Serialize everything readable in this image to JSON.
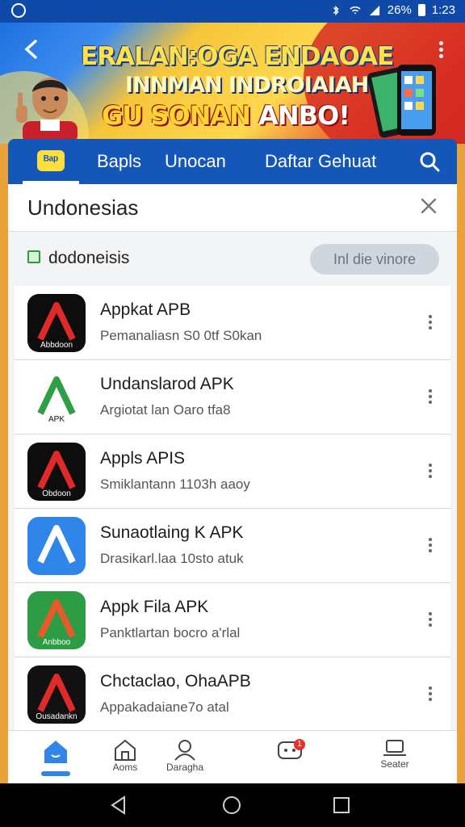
{
  "status_bar": {
    "battery": "26%",
    "time": "1:23"
  },
  "banner": {
    "line1": "ERALAN:OGA ENDAOAE",
    "line2": "INNMAN INDROIAIAH",
    "line3_a": "GU SONAN ",
    "line3_b": "ANBO!"
  },
  "tabs": {
    "home_icon_label": "ᴮᵃᵖ",
    "items": [
      {
        "label": "Bapls"
      },
      {
        "label": "Unocan"
      },
      {
        "label": "Daftar Gehuat"
      }
    ]
  },
  "header": {
    "title": "Undonesias"
  },
  "filter": {
    "label": "dodoneisis",
    "button": "Inl die vinore"
  },
  "apps": [
    {
      "name": "Appkat APB",
      "desc": "Pemanaliasn S0 0tf S0kan",
      "icon_text": "Abbdoon",
      "icon_bg": "#0d0d0d",
      "accent": "#e02a2a"
    },
    {
      "name": "Undanslarod APK",
      "desc": "Argiotat lan Oaro tfa8",
      "icon_text": "APK",
      "icon_bg": "#ffffff",
      "accent": "#2f9e44"
    },
    {
      "name": "Appls APIS",
      "desc": "Smiklantann 1103h aaoy",
      "icon_text": "Obdoon",
      "icon_bg": "#0d0d0d",
      "accent": "#e02a2a"
    },
    {
      "name": "Sunaotlaing K APK",
      "desc": "Drasikarl.laa 10sto atuk",
      "icon_text": "",
      "icon_bg": "#2f86e8",
      "accent": "#ffffff"
    },
    {
      "name": "Appk Fila APK",
      "desc": "Panktlartan bocro a'rlal",
      "icon_text": "Anbboo",
      "icon_bg": "#2d9d45",
      "accent": "#e85a2a"
    },
    {
      "name": "Chctaclao, OhaAPB",
      "desc": "Appakadaiane7o atal",
      "icon_text": "Ousadankn",
      "icon_bg": "#111111",
      "accent": "#e02a2a"
    }
  ],
  "bottom_nav": [
    {
      "label": ""
    },
    {
      "label": "Aoms"
    },
    {
      "label": "Daragha"
    },
    {
      "label": "",
      "badge": "1"
    },
    {
      "label": "Seater"
    }
  ],
  "colors": {
    "primary": "#1557b8",
    "status": "#0f4aa8",
    "accent_yellow": "#ffdf3e",
    "badge": "#e8302a"
  }
}
